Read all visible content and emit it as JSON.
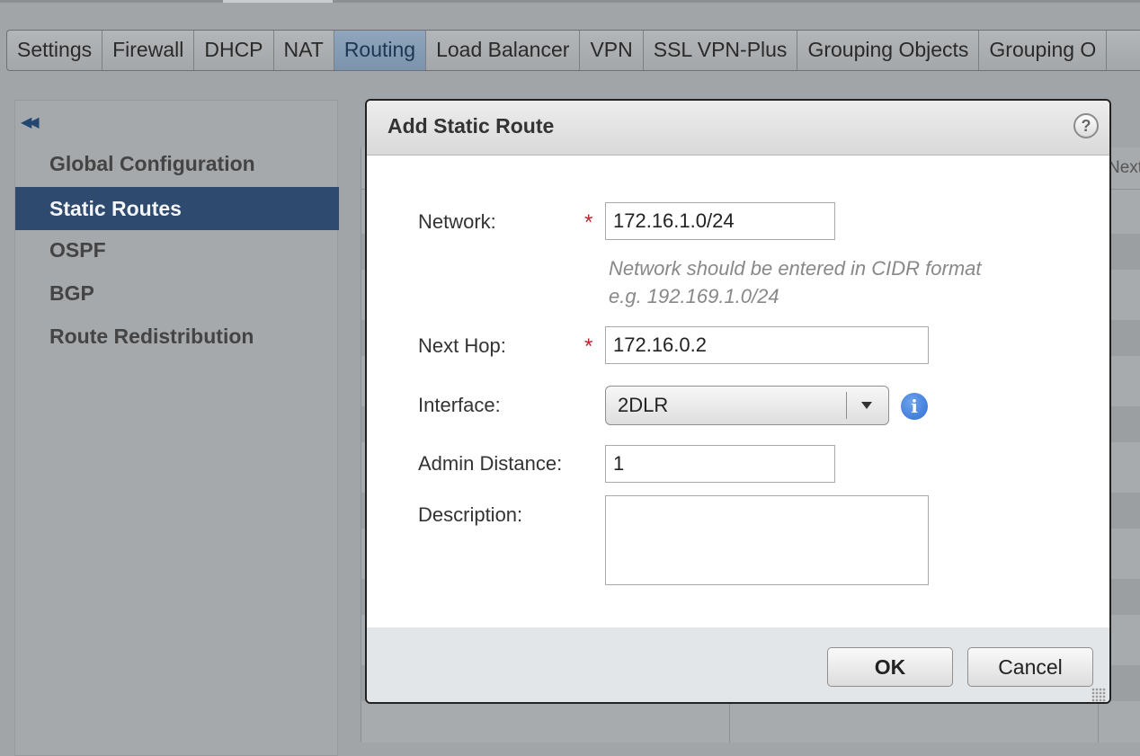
{
  "tabs": [
    "Settings",
    "Firewall",
    "DHCP",
    "NAT",
    "Routing",
    "Load Balancer",
    "VPN",
    "SSL VPN-Plus",
    "Grouping Objects",
    "Grouping O"
  ],
  "active_tab": "Routing",
  "sidebar": {
    "collapse_icon": "double-chevron-left-icon",
    "items": [
      {
        "label": "Global Configuration"
      },
      {
        "label": "Static Routes",
        "active": true
      },
      {
        "label": "OSPF"
      },
      {
        "label": "BGP"
      },
      {
        "label": "Route Redistribution"
      }
    ]
  },
  "background": {
    "column_header_partial": "Next"
  },
  "dialog": {
    "title": "Add Static Route",
    "help_label": "?",
    "network": {
      "label": "Network:",
      "value": "172.16.1.0/24",
      "required": true
    },
    "network_hint": [
      "Network should be entered in CIDR format",
      "e.g. 192.169.1.0/24"
    ],
    "next_hop": {
      "label": "Next Hop:",
      "value": "172.16.0.2",
      "required": true
    },
    "interface": {
      "label": "Interface:",
      "value": "2DLR"
    },
    "admin_distance": {
      "label": "Admin Distance:",
      "value": "1"
    },
    "description": {
      "label": "Description:",
      "value": ""
    },
    "required_marker": "*",
    "info_glyph": "i",
    "ok_label": "OK",
    "cancel_label": "Cancel"
  },
  "colors": {
    "accent_active_nav": "#2e4a6e",
    "active_tab": "#7b93ab",
    "required_marker": "#c8202a",
    "info_icon": "#2f6ed4"
  }
}
